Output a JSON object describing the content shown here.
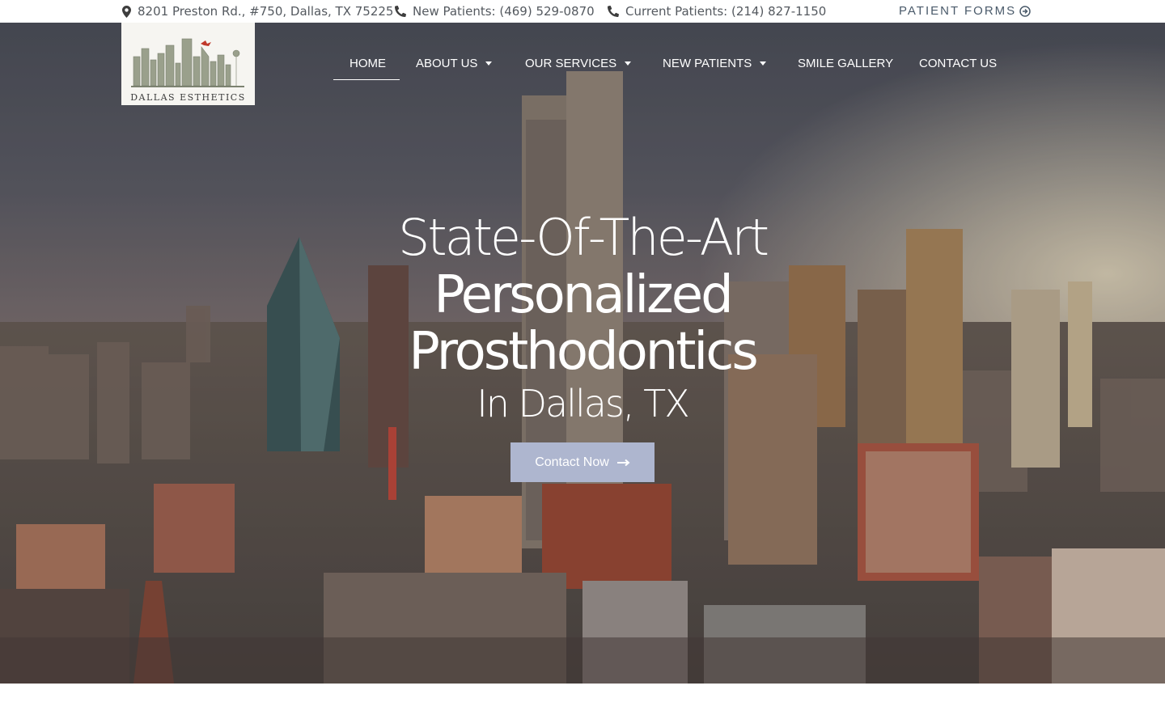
{
  "topbar": {
    "address": "8201 Preston Rd., #750, Dallas, TX 75225",
    "new_patients": "New Patients: (469) 529-0870",
    "current_patients": "Current Patients: (214) 827-1150",
    "patient_forms": "PATIENT FORMS",
    "icons": {
      "address": "map-pin-icon",
      "new_patients": "phone-icon",
      "current_patients": "phone-icon",
      "patient_forms": "arrow-circle-right-icon"
    }
  },
  "logo": {
    "text": "DALLAS ESTHETICS"
  },
  "nav": {
    "items": [
      {
        "label": "HOME",
        "active": true,
        "dropdown": false
      },
      {
        "label": "ABOUT US",
        "active": false,
        "dropdown": true
      },
      {
        "label": "OUR SERVICES",
        "active": false,
        "dropdown": true
      },
      {
        "label": "NEW PATIENTS",
        "active": false,
        "dropdown": true
      },
      {
        "label": "SMILE GALLERY",
        "active": false,
        "dropdown": false
      },
      {
        "label": "CONTACT US",
        "active": false,
        "dropdown": false
      }
    ]
  },
  "hero": {
    "line1": "State-Of-The-Art",
    "line2": "Personalized",
    "line3": "Prosthodontics",
    "line4": "In Dallas, TX",
    "cta_label": "Contact Now",
    "cta_icon": "long-arrow-right-icon"
  },
  "colors": {
    "cta_bg": "#aeb6cf",
    "topbar_text": "#54595f",
    "forms_text": "#4a5a6a"
  }
}
